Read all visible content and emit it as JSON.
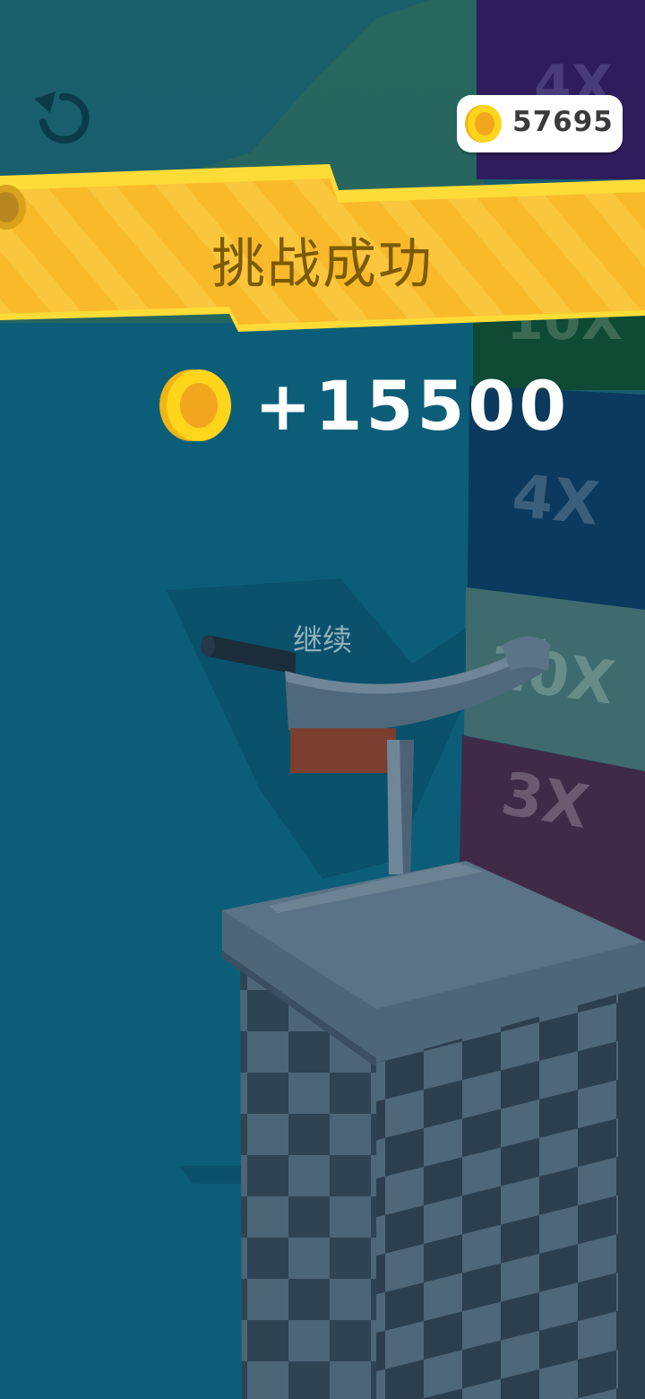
{
  "hud": {
    "coin_balance": "57695",
    "restart_icon": "restart-icon",
    "coin_icon": "coin-icon"
  },
  "banner": {
    "title": "挑战成功"
  },
  "reward": {
    "amount_text": "+15500",
    "coin_icon": "coin-icon"
  },
  "actions": {
    "continue_label": "继续"
  },
  "multiplier_tower": {
    "blocks": [
      {
        "label": "4X",
        "color": "#2e1c5c"
      },
      {
        "label": "10X",
        "color": "#0e4a34"
      },
      {
        "label": "4X",
        "color": "#0b3a5e"
      },
      {
        "label": "10X",
        "color": "#3f6b6e"
      },
      {
        "label": "3X",
        "color": "#3f2a48"
      }
    ]
  },
  "colors": {
    "sky": "#14576a",
    "water": "#0d5a73",
    "banner": "#f6b625",
    "banner_text": "#7d5a05",
    "coin": "#f8c61a"
  }
}
